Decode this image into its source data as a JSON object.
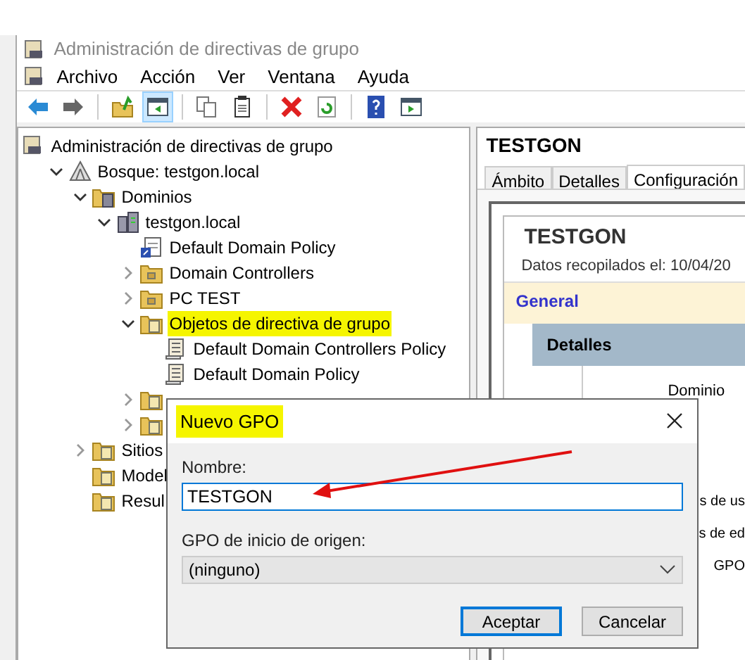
{
  "window": {
    "title": "Administración de directivas de grupo"
  },
  "menu": [
    "Archivo",
    "Acción",
    "Ver",
    "Ventana",
    "Ayuda"
  ],
  "toolbar": [
    {
      "kind": "back",
      "pressed": false
    },
    {
      "kind": "forward",
      "pressed": false
    },
    {
      "kind": "sep"
    },
    {
      "kind": "up",
      "pressed": false
    },
    {
      "kind": "tree",
      "pressed": true
    },
    {
      "kind": "sep"
    },
    {
      "kind": "copy",
      "pressed": false
    },
    {
      "kind": "paste",
      "pressed": false
    },
    {
      "kind": "sep"
    },
    {
      "kind": "delete",
      "pressed": false
    },
    {
      "kind": "refresh",
      "pressed": false
    },
    {
      "kind": "sep"
    },
    {
      "kind": "help",
      "pressed": false
    },
    {
      "kind": "panel",
      "pressed": false
    }
  ],
  "tree": [
    {
      "label": "Administración de directivas de grupo",
      "kind": "console",
      "children": [
        {
          "label": "Bosque: testgon.local",
          "kind": "forest",
          "expanded": true,
          "children": [
            {
              "label": "Dominios",
              "kind": "domains",
              "expanded": true,
              "children": [
                {
                  "label": "testgon.local",
                  "kind": "domain",
                  "expanded": true,
                  "children": [
                    {
                      "label": "Default Domain Policy",
                      "kind": "link"
                    },
                    {
                      "label": "Domain Controllers",
                      "kind": "ou",
                      "expanded": false
                    },
                    {
                      "label": "PC TEST",
                      "kind": "ou",
                      "expanded": false
                    },
                    {
                      "label": "Objetos de directiva de grupo",
                      "kind": "folder",
                      "expanded": true,
                      "highlighted": true,
                      "children": [
                        {
                          "label": "Default Domain Controllers Policy",
                          "kind": "gpo"
                        },
                        {
                          "label": "Default Domain Policy",
                          "kind": "gpo"
                        }
                      ]
                    },
                    {
                      "kind": "folder",
                      "expanded": false
                    },
                    {
                      "kind": "folder",
                      "expanded": false
                    }
                  ]
                }
              ]
            },
            {
              "label": "Sitios",
              "kind": "folder",
              "expanded": false
            },
            {
              "label": "Model",
              "kind": "folder"
            },
            {
              "label": "Resul",
              "kind": "folder"
            }
          ]
        }
      ]
    }
  ],
  "details": {
    "title": "TESTGON",
    "tabs": [
      {
        "label": "Ámbito",
        "selected": false
      },
      {
        "label": "Detalles",
        "selected": false
      },
      {
        "label": "Configuración",
        "selected": true
      }
    ],
    "report": {
      "title": "TESTGON",
      "collected": "Datos recopilados el: 10/04/20",
      "section": "General",
      "subsection": "Detalles",
      "field": "Dominio",
      "fragments": [
        "s de us",
        "s de ed",
        "GPO"
      ]
    }
  },
  "dialog": {
    "title": "Nuevo GPO",
    "title_highlighted": true,
    "name_label": "Nombre:",
    "name_value": "TESTGON",
    "source_label": "GPO de inicio de origen:",
    "source_value": "(ninguno)",
    "buttons": [
      {
        "label": "Aceptar",
        "default": true
      },
      {
        "label": "Cancelar",
        "default": false
      }
    ]
  }
}
